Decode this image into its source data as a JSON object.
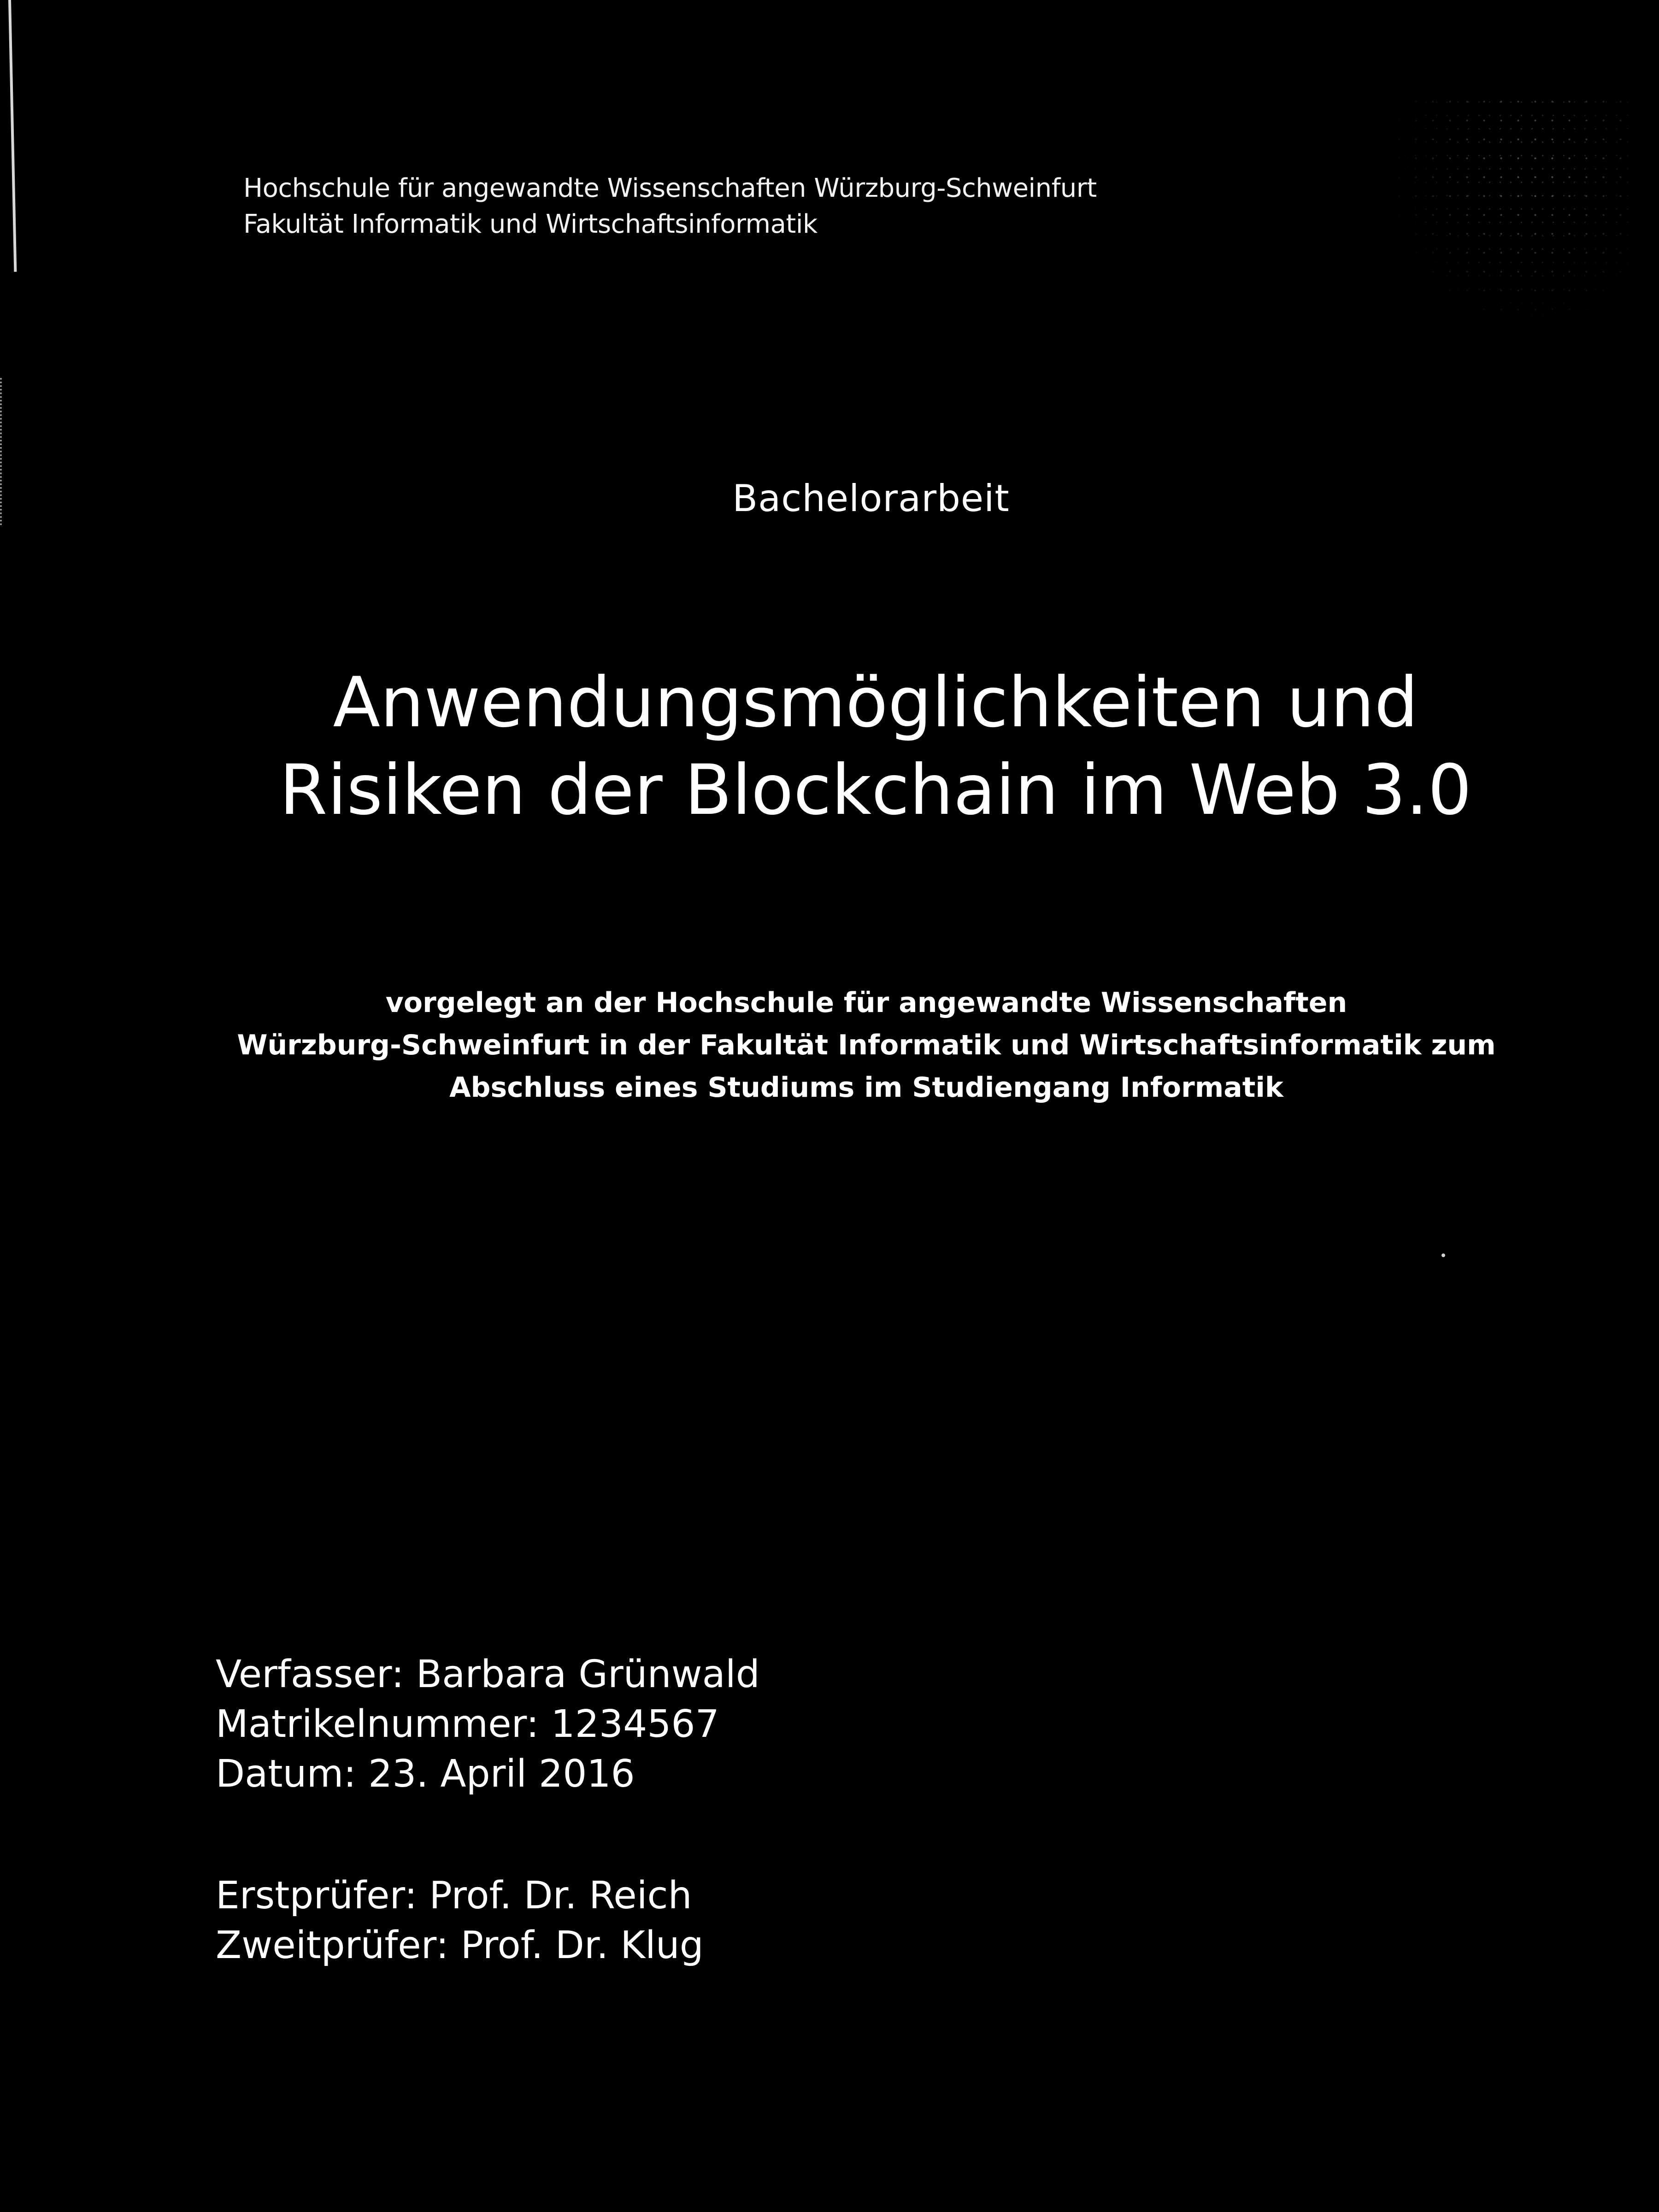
{
  "colors": {
    "background": "#000000",
    "text": "#ffffff"
  },
  "header": {
    "university": "Hochschule für angewandte Wissenschaften Würzburg-Schweinfurt",
    "faculty": "Fakultät Informatik und Wirtschaftsinformatik"
  },
  "doc_type": "Bachelorarbeit",
  "title": {
    "line1": "Anwendungsmöglichkeiten und",
    "line2": "Risiken der Blockchain im Web 3.0"
  },
  "submission": {
    "line1": "vorgelegt an der Hochschule für angewandte Wissenschaften",
    "line2": "Würzburg-Schweinfurt in der Fakultät Informatik und Wirtschaftsinformatik zum",
    "line3": "Abschluss eines Studiums im Studiengang Informatik"
  },
  "author_info": {
    "author": "Verfasser: Barbara Grünwald",
    "matriculation": "Matrikelnummer: 1234567",
    "date": "Datum: 23. April 2016"
  },
  "examiners": {
    "first": "Erstprüfer: Prof. Dr. Reich",
    "second": "Zweitprüfer: Prof. Dr. Klug"
  }
}
